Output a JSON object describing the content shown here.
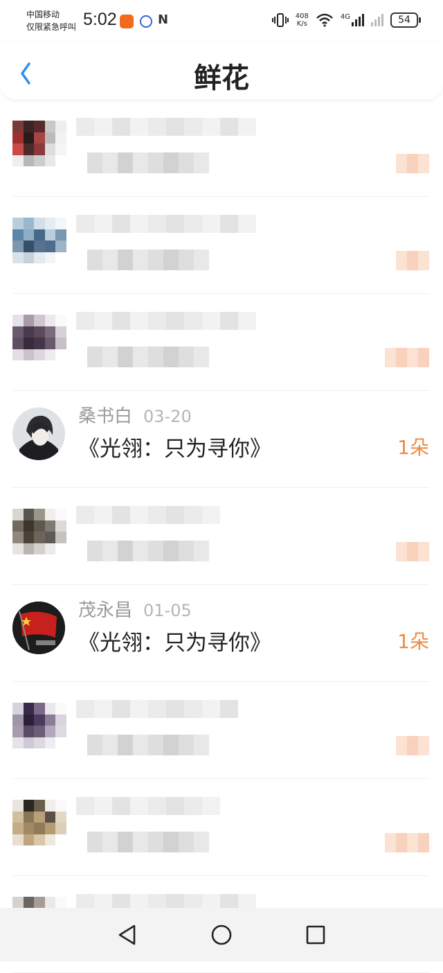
{
  "status_bar": {
    "carrier_line1": "中国移动",
    "carrier_line2": "仅限紧急呼叫",
    "time": "5:02",
    "net_speed_value": "408",
    "net_speed_unit": "K/s",
    "network_type": "4G",
    "battery": "54"
  },
  "header": {
    "title": "鲜花",
    "back_icon": "chevron-left-icon"
  },
  "records": [
    {
      "id": "r1",
      "name": "",
      "date": "",
      "gift": "",
      "count": "",
      "blurred": true
    },
    {
      "id": "r2",
      "name": "",
      "date": "",
      "gift": "",
      "count": "",
      "blurred": true
    },
    {
      "id": "r3",
      "name": "",
      "date": "",
      "gift": "",
      "count": "",
      "blurred": true
    },
    {
      "id": "r4",
      "name": "桑书白",
      "date": "03-20",
      "gift": "《光翎：只为寻你》",
      "count": "1朵",
      "blurred": false
    },
    {
      "id": "r5",
      "name": "",
      "date": "",
      "gift": "",
      "count": "",
      "blurred": true
    },
    {
      "id": "r6",
      "name": "茂永昌",
      "date": "01-05",
      "gift": "《光翎：只为寻你》",
      "count": "1朵",
      "blurred": false
    },
    {
      "id": "r7",
      "name": "",
      "date": "",
      "gift": "",
      "count": "",
      "blurred": true
    },
    {
      "id": "r8",
      "name": "",
      "date": "",
      "gift": "",
      "count": "",
      "blurred": true
    },
    {
      "id": "r9",
      "name": "",
      "date": "",
      "gift": "",
      "count": "",
      "blurred": true
    }
  ],
  "nav": {
    "back_icon": "triangle-back-icon",
    "home_icon": "circle-home-icon",
    "recents_icon": "square-recents-icon"
  },
  "colors": {
    "accent_blue": "#2d8cf0",
    "count_orange": "#ec8b44",
    "name_gray": "#9a9a9a"
  }
}
